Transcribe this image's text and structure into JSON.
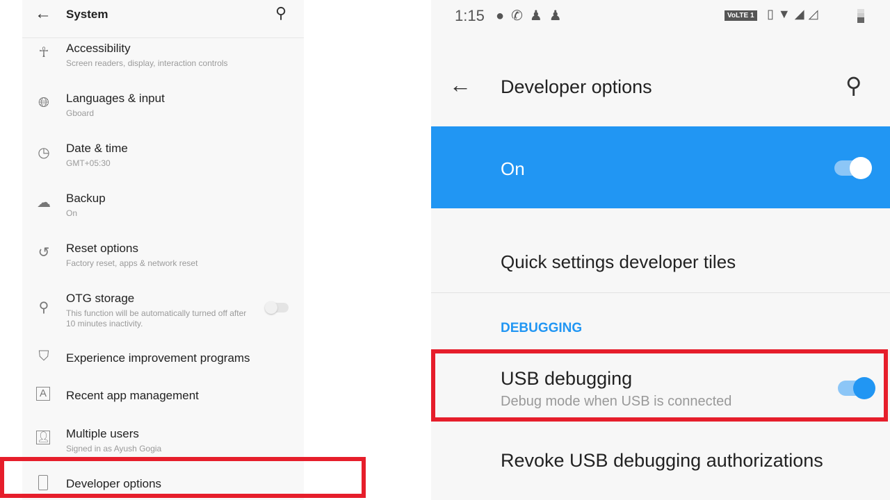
{
  "left": {
    "header": {
      "title": "System"
    },
    "items": [
      {
        "title": "Accessibility",
        "subtitle": "Screen readers, display, interaction controls",
        "icon": "accessibility-icon"
      },
      {
        "title": "Languages & input",
        "subtitle": "Gboard",
        "icon": "globe-icon"
      },
      {
        "title": "Date & time",
        "subtitle": "GMT+05:30",
        "icon": "clock-icon"
      },
      {
        "title": "Backup",
        "subtitle": "On",
        "icon": "cloud-icon"
      },
      {
        "title": "Reset options",
        "subtitle": "Factory reset, apps & network reset",
        "icon": "history-icon"
      },
      {
        "title": "OTG storage",
        "subtitle": "This function will be automatically turned off after 10 minutes inactivity.",
        "icon": "usb-icon",
        "toggle": false
      },
      {
        "title": "Experience improvement programs",
        "icon": "shield-icon"
      },
      {
        "title": "Recent app management",
        "icon": "recent-apps-icon"
      },
      {
        "title": "Multiple users",
        "subtitle": "Signed in as Ayush Gogia",
        "icon": "user-icon"
      },
      {
        "title": "Developer options",
        "icon": "phone-icon"
      }
    ]
  },
  "right": {
    "status": {
      "time": "1:15",
      "volte": "VoLTE 1"
    },
    "header": {
      "title": "Developer options"
    },
    "master": {
      "label": "On",
      "enabled": true
    },
    "items": {
      "quick_tiles": "Quick settings developer tiles",
      "section": "DEBUGGING",
      "usb_title": "USB debugging",
      "usb_sub": "Debug mode when USB is connected",
      "usb_enabled": true,
      "revoke": "Revoke USB debugging authorizations"
    }
  },
  "colors": {
    "accent": "#2196f3",
    "highlight": "#e61e2b"
  }
}
